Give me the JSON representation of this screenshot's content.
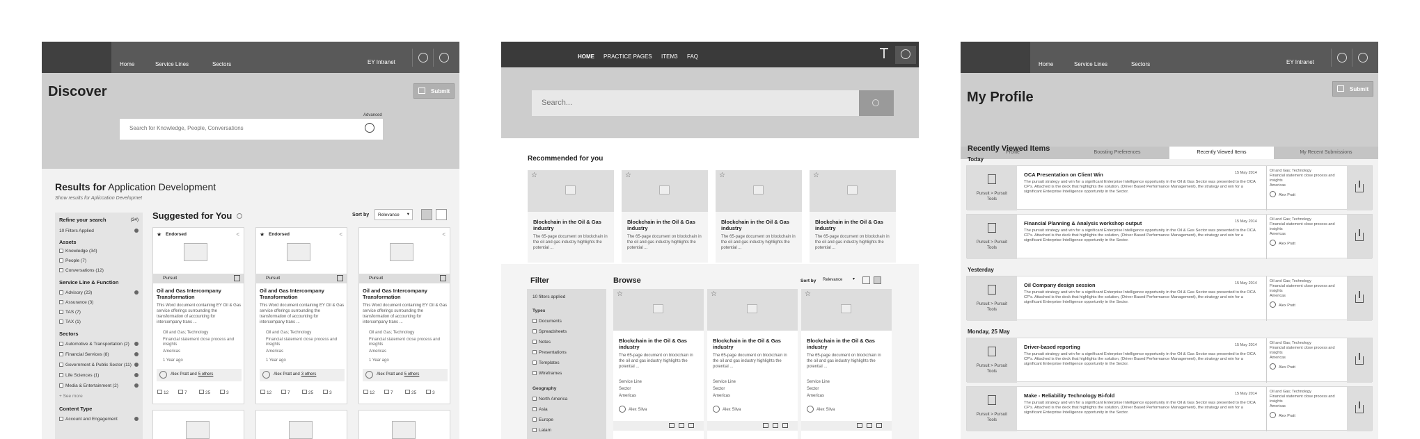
{
  "p1": {
    "nav": [
      "Home",
      "Service Lines",
      "Sectors"
    ],
    "intranet": "EY Intranet",
    "title": "Discover",
    "submit": "Submit",
    "advanced": "Advanced",
    "search_placeholder": "Search for Knowledge, People, Conversations",
    "results_prefix": "Results for",
    "results_query": "Application Development",
    "results_sub": "Show results for Apliccation Developmet",
    "refine": "Refine your search",
    "refine_count": "(34)",
    "filters_applied": "10 Filters Applied",
    "assets_h": "Assets",
    "assets": [
      "Knowledge (34)",
      "People (7)",
      "Conversations (12)"
    ],
    "slf_h": "Service Line & Function",
    "slf": [
      "Advisory (23)",
      "Assurance (3)",
      "TAS (7)",
      "TAX (1)"
    ],
    "sectors_h": "Sectors",
    "sectors": [
      "Automotive & Transportation (2)",
      "Financial Services (8)",
      "Government & Public Sector (11)",
      "Life Sciences (1)",
      "Media & Entertainment (2)"
    ],
    "see_more": "+ See more",
    "ctype_h": "Content Type",
    "ctype": [
      "Account and Engagement"
    ],
    "suggested": "Suggested for You",
    "sortby": "Sort by",
    "sort_value": "Relevance",
    "cards": [
      {
        "badge": "Endorsed",
        "type": "Pursuit",
        "title": "Oil and Gas Intercompany Transformation",
        "desc": "This Word document containing EY Oil & Gas service offerings surrounding the transformation of accounting for intercompany trans ...",
        "tag1": "Oil and Gas; Technology",
        "tag2": "Financial statement close process and insights",
        "region": "Americas",
        "age": "1 Year ago",
        "people": "Alex Pratt and",
        "others": "5 others",
        "stats": [
          "12",
          "7",
          "25",
          "3"
        ]
      },
      {
        "badge": "Endorsed",
        "type": "Pursuit",
        "title": "Oil and Gas Intercompany Transformation",
        "desc": "This Word document containing EY Oil & Gas service offerings surrounding the transformation of accounting for intercompany trans ...",
        "tag1": "Oil and Gas; Technology",
        "tag2": "Financial statement close process and insights",
        "region": "Americas",
        "age": "1 Year ago",
        "people": "Alex Pratt and",
        "others": "3 others",
        "stats": [
          "12",
          "7",
          "25",
          "3"
        ]
      },
      {
        "badge": "",
        "type": "Pursuit",
        "title": "Oil and Gas Intercompany Transformation",
        "desc": "This Word document containing EY Oil & Gas service offerings surrounding the transformation of accounting for intercompany trans ...",
        "tag1": "Oil and Gas; Technology",
        "tag2": "Financial statement close process and insights",
        "region": "Americas",
        "age": "1 Year ago",
        "people": "Alex Pratt and",
        "others": "5 others",
        "stats": [
          "12",
          "7",
          "25",
          "3"
        ]
      }
    ]
  },
  "p2": {
    "nav": [
      "HOME",
      "PRACTICE PAGES",
      "ITEM3",
      "FAQ"
    ],
    "search_placeholder": "Search...",
    "recommended": "Recommended for you",
    "rec": [
      {
        "title": "Blockchain in the Oil & Gas industry",
        "desc": "The 65-page document on blockchain in the oil and gas industry highlights the potential ..."
      },
      {
        "title": "Blockchain in the Oil & Gas industry",
        "desc": "The 65-page document on blockchain in the oil and gas industry highlights the potential ..."
      },
      {
        "title": "Blockchain in the Oil & Gas industry",
        "desc": "The 65-page document on blockchain in the oil and gas industry highlights the potential ..."
      },
      {
        "title": "Blockchain in the Oil & Gas industry",
        "desc": "The 65-page document on blockchain in the oil and gas industry highlights the potential ..."
      }
    ],
    "filter": "Filter",
    "filters_applied": "10 filters applied",
    "types_h": "Types",
    "types": [
      "Documents",
      "Spreadsheets",
      "Notes",
      "Presentations",
      "Templates",
      "Wireframes"
    ],
    "geo_h": "Geography",
    "geo": [
      "North America",
      "Asia",
      "Europe",
      "Latam"
    ],
    "browse": "Browse",
    "sortby": "Sort by",
    "sort_value": "Relevance",
    "items": [
      {
        "title": "Blockchain in the Oil & Gas industry",
        "desc": "The 65-page document on blockchain in the oil and gas industry highlights the potential ...",
        "l1": "Service Line",
        "l2": "Sector",
        "l3": "Americas",
        "author": "Alex Silva"
      },
      {
        "title": "Blockchain in the Oil & Gas industry",
        "desc": "The 65-page document on blockchain in the oil and gas industry highlights the potential ...",
        "l1": "Service Line",
        "l2": "Sector",
        "l3": "Americas",
        "author": "Alex Silva"
      },
      {
        "title": "Blockchain in the Oil & Gas industry",
        "desc": "The 65-page document on blockchain in the oil and gas industry highlights the potential ...",
        "l1": "Service Line",
        "l2": "Sector",
        "l3": "Americas",
        "author": "Alex Silva"
      }
    ]
  },
  "p3": {
    "nav": [
      "Home",
      "Service Lines",
      "Sectors"
    ],
    "intranet": "EY Intranet",
    "title": "My Profile",
    "submit": "Submit",
    "tabs": [
      "Profile",
      "Boosting Preferences",
      "Recently Viewed Items",
      "My Recent Submissions"
    ],
    "heading": "Recently Viewed Items",
    "groups": [
      {
        "label": "Today",
        "items": [
          {
            "type": "Pursuit > Pursuit Tools",
            "title": "OCA Presentation on Client Win",
            "date": "15 May 2014"
          },
          {
            "type": "Pursuit > Pursuit Tools",
            "title": "Financial Planning & Analysis workshop output",
            "date": "15 May 2014"
          }
        ]
      },
      {
        "label": "Yesterday",
        "items": [
          {
            "type": "Pursuit > Pursuit Tools",
            "title": "Oil Company design session",
            "date": "15 May 2014"
          }
        ]
      },
      {
        "label": "Monday, 25 May",
        "items": [
          {
            "type": "Pursuit > Pursuit Tools",
            "title": "Driver-based reporting",
            "date": "15 May 2014"
          },
          {
            "type": "Pursuit > Pursuit Tools",
            "title": "Make - Reliability Technology Bi-fold",
            "date": "15 May 2014"
          }
        ]
      }
    ],
    "desc": "The pursuit strategy and win for a significant Enterprise Intelligence opportunity in the Oil & Gas Sector was presented to the OCA CP's. Attached is the deck that highlights the solution, (Driver Based Performance Management), the strategy and win for a significant Enterprise Intelligence opportunity in the Sector.",
    "meta1": "Oil and Gas; Technology",
    "meta2": "Financial statement close process and insights",
    "meta3": "Americas",
    "person": "Alex Pratt"
  }
}
